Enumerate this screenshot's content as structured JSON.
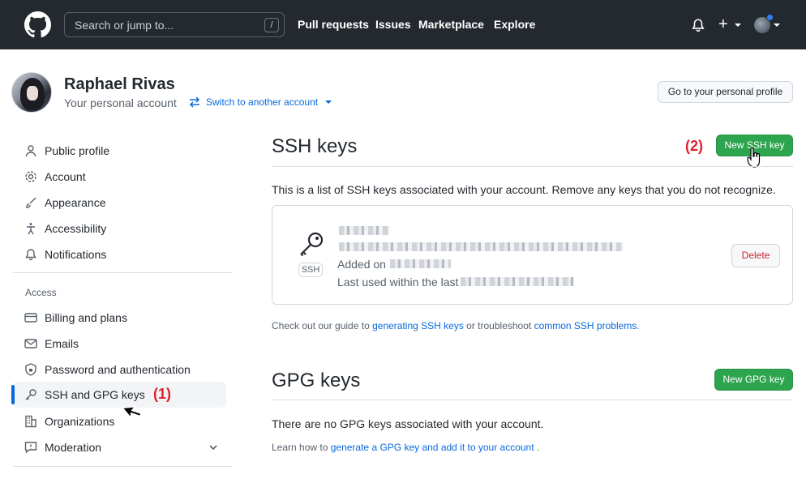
{
  "header": {
    "search_placeholder": "Search or jump to...",
    "search_shortcut": "/",
    "nav": [
      "Pull requests",
      "Issues",
      "Marketplace",
      "Explore"
    ],
    "plus_label": "+"
  },
  "profile": {
    "name": "Raphael Rivas",
    "subtitle": "Your personal account",
    "switch_label": "Switch to another account",
    "go_profile_label": "Go to your personal profile"
  },
  "sidebar": {
    "items": [
      {
        "label": "Public profile",
        "icon": "person-icon"
      },
      {
        "label": "Account",
        "icon": "gear-icon"
      },
      {
        "label": "Appearance",
        "icon": "paintbrush-icon"
      },
      {
        "label": "Accessibility",
        "icon": "accessibility-icon"
      },
      {
        "label": "Notifications",
        "icon": "bell-icon"
      }
    ],
    "access_heading": "Access",
    "access_items": [
      {
        "label": "Billing and plans",
        "icon": "credit-card-icon"
      },
      {
        "label": "Emails",
        "icon": "mail-icon"
      },
      {
        "label": "Password and authentication",
        "icon": "shield-lock-icon"
      },
      {
        "label": "SSH and GPG keys",
        "icon": "key-icon",
        "active": true
      },
      {
        "label": "Organizations",
        "icon": "organization-icon"
      },
      {
        "label": "Moderation",
        "icon": "report-icon"
      }
    ]
  },
  "annotations": {
    "step1": "(1)",
    "step2": "(2)"
  },
  "ssh": {
    "title": "SSH keys",
    "new_button": "New SSH key",
    "description": "This is a list of SSH keys associated with your account. Remove any keys that you do not recognize.",
    "key": {
      "badge": "SSH",
      "added_prefix": "Added on",
      "last_used_prefix": "Last used within the last",
      "delete_label": "Delete"
    },
    "guide_prefix": "Check out our guide to",
    "guide_link1": "generating SSH keys",
    "guide_middle": "or troubleshoot",
    "guide_link2": "common SSH problems",
    "guide_suffix": "."
  },
  "gpg": {
    "title": "GPG keys",
    "new_button": "New GPG key",
    "empty_text": "There are no GPG keys associated with your account.",
    "learn_prefix": "Learn how to",
    "learn_link": "generate a GPG key and add it to your account",
    "learn_suffix": "."
  },
  "colors": {
    "header_bg": "#24292f",
    "link": "#0969da",
    "green": "#2da44e",
    "danger": "#cf222e",
    "annotation": "#e0202c"
  }
}
